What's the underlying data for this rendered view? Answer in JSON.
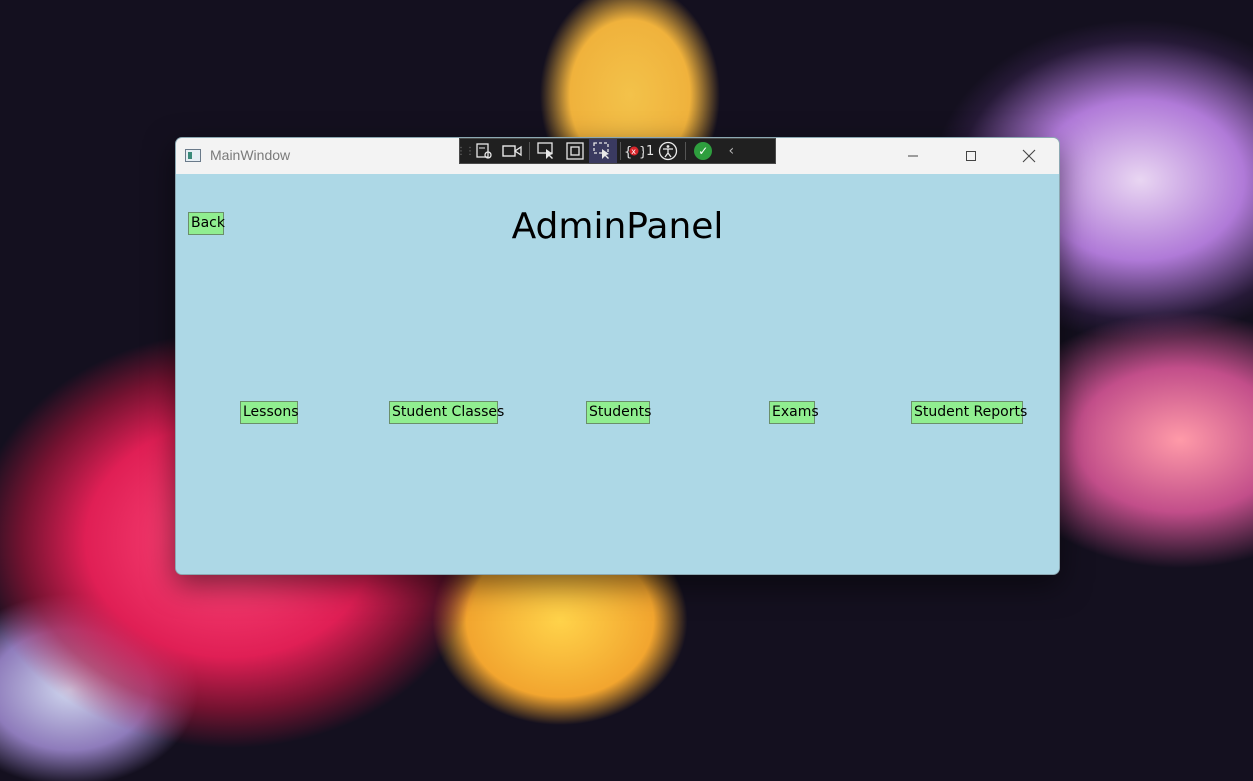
{
  "window": {
    "title": "MainWindow",
    "minimize_icon": "minimize-icon",
    "maximize_icon": "maximize-icon",
    "close_icon": "close-icon"
  },
  "dev_toolbar": {
    "binding_failures_count": "1",
    "icons": [
      "live-visual-tree-icon",
      "record-icon",
      "select-element-icon",
      "display-layout-adorners-icon",
      "track-focus-icon",
      "binding-failures-icon",
      "accessibility-icon",
      "hot-reload-check-icon",
      "collapse-chevron-icon"
    ]
  },
  "page": {
    "title": "AdminPanel",
    "back_label": "Back",
    "buttons": [
      "Lessons",
      "Student Classes",
      "Students",
      "Exams",
      "Student Reports"
    ]
  },
  "colors": {
    "content_background": "#add8e6",
    "button_background": "#90ee90"
  }
}
